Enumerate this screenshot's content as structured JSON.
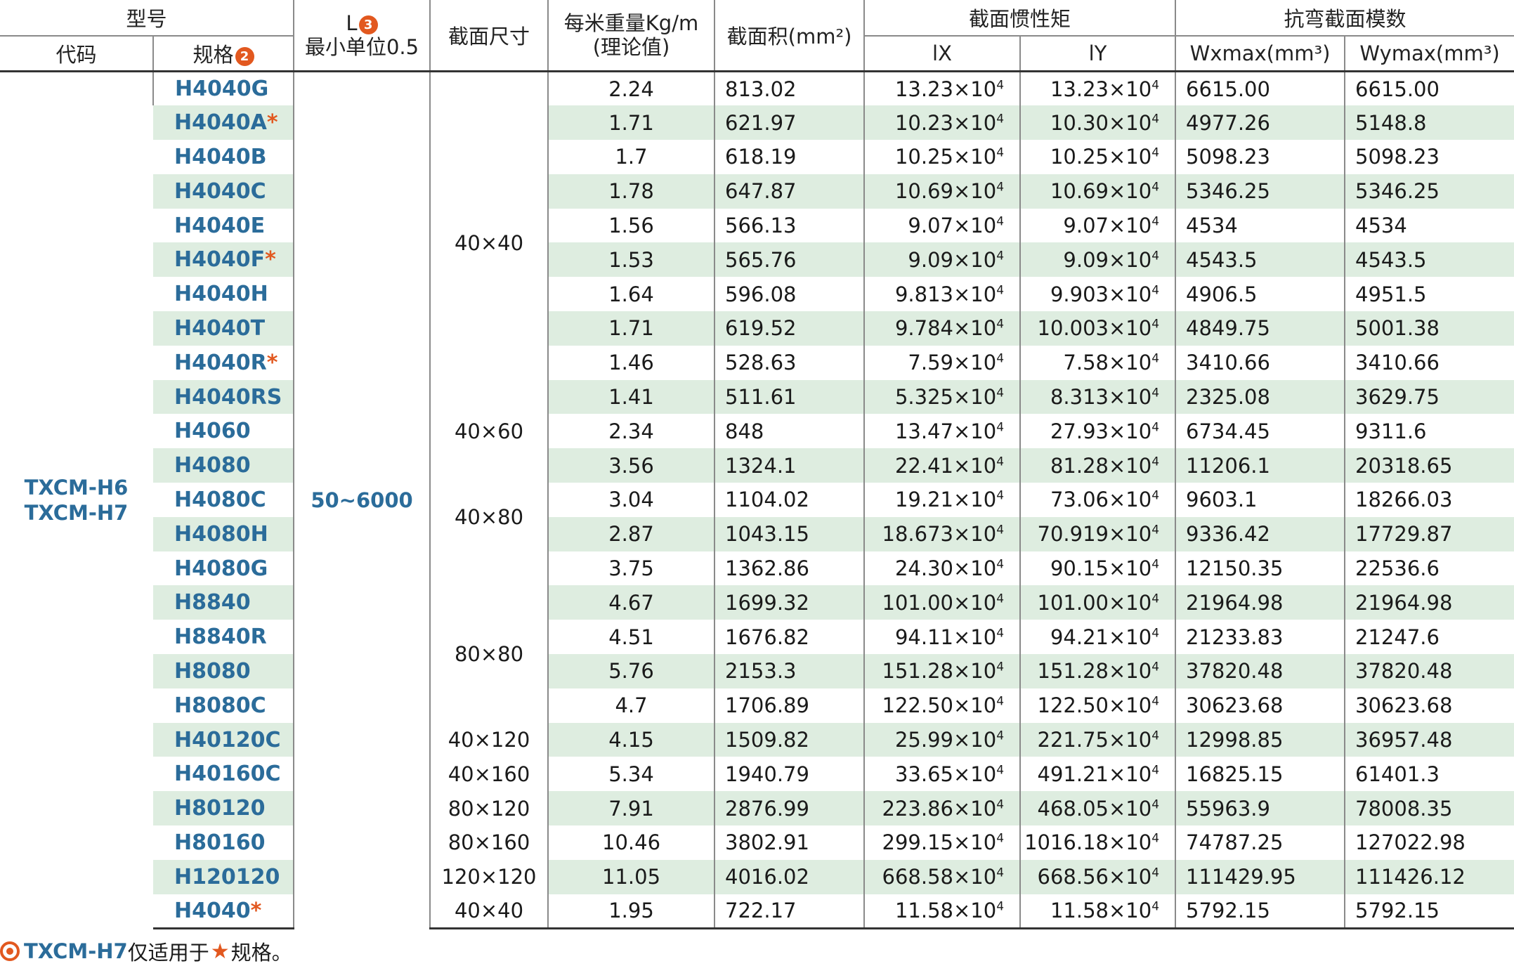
{
  "header": {
    "model": "型号",
    "code": "代码",
    "spec": "规格",
    "spec_badge": "2",
    "length": "L",
    "length_badge": "3",
    "length_sub": "最小单位0.5",
    "section_size": "截面尺寸",
    "weight_line1": "每米重量Kg/m",
    "weight_line2": "(理论值)",
    "area": "截面积(mm²)",
    "inertia": "截面惯性矩",
    "ix": "lX",
    "iy": "lY",
    "modulus": "抗弯截面模数",
    "wx": "Wxmax(mm³)",
    "wy": "Wymax(mm³)"
  },
  "group": {
    "code_line1": "TXCM-H6",
    "code_line2": "TXCM-H7",
    "length_range": "50~6000"
  },
  "sizes": [
    "40×40",
    "40×60",
    "40×80",
    "80×80",
    "40×120",
    "40×160",
    "80×120",
    "80×160",
    "120×120",
    "40×40"
  ],
  "rows": [
    {
      "spec": "H4040G",
      "star": "",
      "weight": "2.24",
      "area": "813.02",
      "ix": "13.23×10",
      "iy": "13.23×10",
      "wx": "6615.00",
      "wy": "6615.00"
    },
    {
      "spec": "H4040A",
      "star": "*",
      "weight": "1.71",
      "area": "621.97",
      "ix": "10.23×10",
      "iy": "10.30×10",
      "wx": "4977.26",
      "wy": "5148.8"
    },
    {
      "spec": "H4040B",
      "star": "",
      "weight": "1.7",
      "area": "618.19",
      "ix": "10.25×10",
      "iy": "10.25×10",
      "wx": "5098.23",
      "wy": "5098.23"
    },
    {
      "spec": "H4040C",
      "star": "",
      "weight": "1.78",
      "area": "647.87",
      "ix": "10.69×10",
      "iy": "10.69×10",
      "wx": "5346.25",
      "wy": "5346.25"
    },
    {
      "spec": "H4040E",
      "star": "",
      "weight": "1.56",
      "area": "566.13",
      "ix": "9.07×10",
      "iy": "9.07×10",
      "wx": "4534",
      "wy": "4534"
    },
    {
      "spec": "H4040F",
      "star": "*",
      "weight": "1.53",
      "area": "565.76",
      "ix": "9.09×10",
      "iy": "9.09×10",
      "wx": "4543.5",
      "wy": "4543.5"
    },
    {
      "spec": "H4040H",
      "star": "",
      "weight": "1.64",
      "area": "596.08",
      "ix": "9.813×10",
      "iy": "9.903×10",
      "wx": "4906.5",
      "wy": "4951.5"
    },
    {
      "spec": "H4040T",
      "star": "",
      "weight": "1.71",
      "area": "619.52",
      "ix": "9.784×10",
      "iy": "10.003×10",
      "wx": "4849.75",
      "wy": "5001.38"
    },
    {
      "spec": "H4040R",
      "star": "*",
      "weight": "1.46",
      "area": "528.63",
      "ix": "7.59×10",
      "iy": "7.58×10",
      "wx": "3410.66",
      "wy": "3410.66"
    },
    {
      "spec": "H4040RS",
      "star": "",
      "weight": "1.41",
      "area": "511.61",
      "ix": "5.325×10",
      "iy": "8.313×10",
      "wx": "2325.08",
      "wy": "3629.75"
    },
    {
      "spec": "H4060",
      "star": "",
      "weight": "2.34",
      "area": "848",
      "ix": "13.47×10",
      "iy": "27.93×10",
      "wx": "6734.45",
      "wy": "9311.6"
    },
    {
      "spec": "H4080",
      "star": "",
      "weight": "3.56",
      "area": "1324.1",
      "ix": "22.41×10",
      "iy": "81.28×10",
      "wx": "11206.1",
      "wy": "20318.65"
    },
    {
      "spec": "H4080C",
      "star": "",
      "weight": "3.04",
      "area": "1104.02",
      "ix": "19.21×10",
      "iy": "73.06×10",
      "wx": "9603.1",
      "wy": "18266.03"
    },
    {
      "spec": "H4080H",
      "star": "",
      "weight": "2.87",
      "area": "1043.15",
      "ix": "18.673×10",
      "iy": "70.919×10",
      "wx": "9336.42",
      "wy": "17729.87"
    },
    {
      "spec": "H4080G",
      "star": "",
      "weight": "3.75",
      "area": "1362.86",
      "ix": "24.30×10",
      "iy": "90.15×10",
      "wx": "12150.35",
      "wy": "22536.6"
    },
    {
      "spec": "H8840",
      "star": "",
      "weight": "4.67",
      "area": "1699.32",
      "ix": "101.00×10",
      "iy": "101.00×10",
      "wx": "21964.98",
      "wy": "21964.98"
    },
    {
      "spec": "H8840R",
      "star": "",
      "weight": "4.51",
      "area": "1676.82",
      "ix": "94.11×10",
      "iy": "94.21×10",
      "wx": "21233.83",
      "wy": "21247.6"
    },
    {
      "spec": "H8080",
      "star": "",
      "weight": "5.76",
      "area": "2153.3",
      "ix": "151.28×10",
      "iy": "151.28×10",
      "wx": "37820.48",
      "wy": "37820.48"
    },
    {
      "spec": "H8080C",
      "star": "",
      "weight": "4.7",
      "area": "1706.89",
      "ix": "122.50×10",
      "iy": "122.50×10",
      "wx": "30623.68",
      "wy": "30623.68"
    },
    {
      "spec": "H40120C",
      "star": "",
      "weight": "4.15",
      "area": "1509.82",
      "ix": "25.99×10",
      "iy": "221.75×10",
      "wx": "12998.85",
      "wy": "36957.48"
    },
    {
      "spec": "H40160C",
      "star": "",
      "weight": "5.34",
      "area": "1940.79",
      "ix": "33.65×10",
      "iy": "491.21×10",
      "wx": "16825.15",
      "wy": "61401.3"
    },
    {
      "spec": "H80120",
      "star": "",
      "weight": "7.91",
      "area": "2876.99",
      "ix": "223.86×10",
      "iy": "468.05×10",
      "wx": "55963.9",
      "wy": "78008.35"
    },
    {
      "spec": "H80160",
      "star": "",
      "weight": "10.46",
      "area": "3802.91",
      "ix": "299.15×10",
      "iy": "1016.18×10",
      "wx": "74787.25",
      "wy": "127022.98"
    },
    {
      "spec": "H120120",
      "star": "",
      "weight": "11.05",
      "area": "4016.02",
      "ix": "668.58×10",
      "iy": "668.56×10",
      "wx": "111429.95",
      "wy": "111426.12"
    },
    {
      "spec": "H4040",
      "star": "*",
      "weight": "1.95",
      "area": "722.17",
      "ix": "11.58×10",
      "iy": "11.58×10",
      "wx": "5792.15",
      "wy": "5792.15"
    }
  ],
  "exponent": "4",
  "note": {
    "code": "TXCM-H7",
    "text1": "仅适用于",
    "star": "★",
    "text2": "规格。"
  }
}
